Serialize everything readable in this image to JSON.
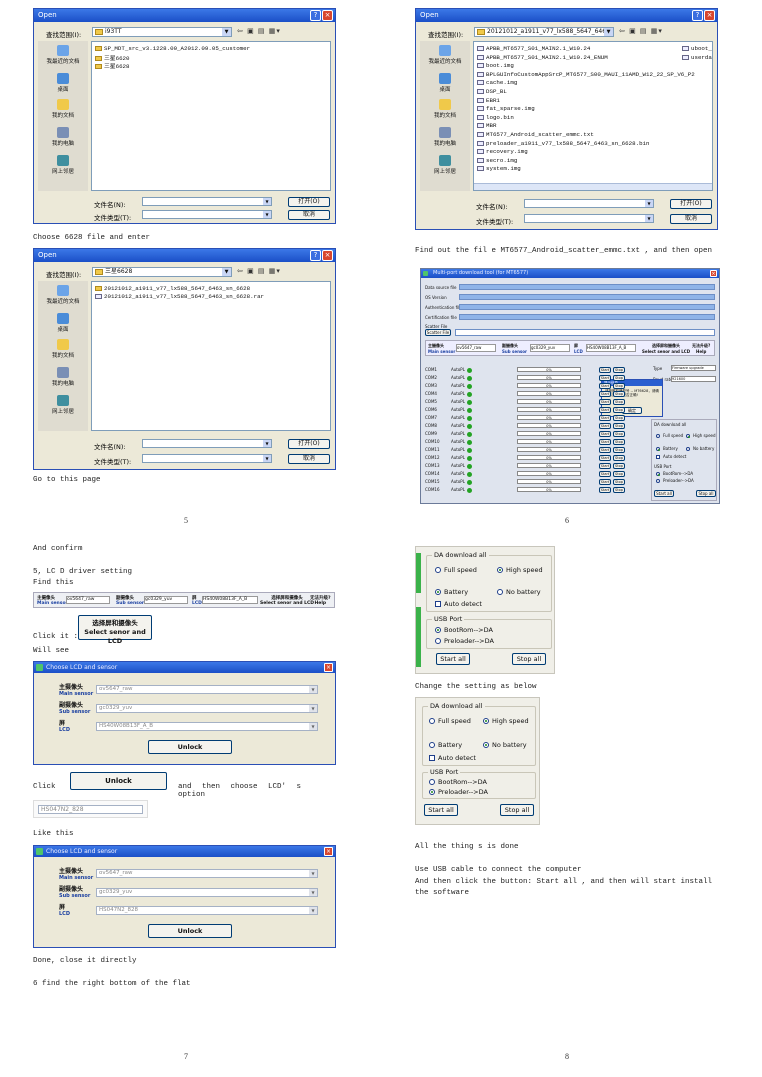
{
  "page_left_top": {
    "dialog1": {
      "title": "Open",
      "lookin_label": "查找范围(I):",
      "lookin_value": "i93TT",
      "toolbar_icons": "⇦ ▣ ▤ ▦▾",
      "places": [
        "我最近的文档",
        "桌面",
        "我的文档",
        "我的电脑",
        "网上邻居"
      ],
      "files": [
        "SP_MDT_src_v3.1228.00_A2012.09.05_customer",
        "三星6620",
        "三星6628"
      ],
      "filename_label": "文件名(N):",
      "filetype_label": "文件类型(T):",
      "open_button": "打开(O)",
      "cancel_button": "取消"
    },
    "caption1": "Choose 6628 file and enter",
    "dialog2": {
      "title": "Open",
      "lookin_label": "查找范围(I):",
      "lookin_value": "三星6628",
      "toolbar_icons": "⇦ ▣ ▤ ▦▾",
      "places": [
        "我最近的文档",
        "桌面",
        "我的文档",
        "我的电脑",
        "网上邻居"
      ],
      "files": [
        "20121012_a1911_v77_lx588_5647_6463_sn_6628",
        "20121012_a1911_v77_lx588_5647_6463_sn_6628.rar"
      ],
      "filename_label": "文件名(N):",
      "filetype_label": "文件类型(T):",
      "open_button": "打开(O)",
      "cancel_button": "取消"
    },
    "caption2": "Go to this page",
    "page_number": "5"
  },
  "page_right_top": {
    "dialog": {
      "title": "Open",
      "lookin_label": "查找范围(I):",
      "lookin_value": "20121012_a1911_v77_lx588_5647_6463_s",
      "toolbar_icons": "⇦ ▣ ▤ ▦▾",
      "places": [
        "我最近的文档",
        "桌面",
        "我的文档",
        "我的电脑",
        "网上邻居"
      ],
      "files": [
        "APBB_MT6577_S01_MAIN2.1_W10.24",
        "APBB_MT6577_S01_MAIN2.1_W10.24_ENUM",
        "boot.img",
        "BPLGUInfoCustomAppSrcP_MT6577_S00_MAUI_11AMD_W12_22_SP_V6_P2",
        "cache.img",
        "DSP_BL",
        "EBR1",
        "fat_sparse.img",
        "logo.bin",
        "MBR",
        "MT6577_Android_scatter_emmc.txt",
        "preloader_a1911_v77_lx588_5647_6463_sn_6628.bin",
        "recovery.img",
        "secro.img",
        "system.img"
      ],
      "files_col2": [
        "uboot_a",
        "userdat"
      ],
      "filename_label": "文件名(N):",
      "filetype_label": "文件类型(T):",
      "open_button": "打开(O)",
      "cancel_button": "取消"
    },
    "caption": "Find  out  the  fil e  MT6577_Android_scatter_emmc.txt  ,  and  then  open",
    "flash_tool": {
      "title": "Multi-port download tool (for MT6577)",
      "row_labels": [
        "Data source file",
        "OS Version",
        "Authentication file",
        "Certification file"
      ],
      "scatter_label": "Scatter File",
      "scatter_button": "Scatter File",
      "main_sensor_label": "主摄像头",
      "main_sensor_en": "Main sensor",
      "main_sensor_value": "ov5647_raw",
      "sub_sensor_label": "副摄像头",
      "sub_sensor_en": "Sub sensor",
      "sub_sensor_value": "gc0329_yuv",
      "lcd_label": "屏",
      "lcd_en": "LCD",
      "lcd_value": "HS40W08B13F_A_B",
      "select_button": "选择屏和摄像头",
      "select_button_en": "Select senor and LCD",
      "help_button": "无法升级?",
      "help_button_en": "Help",
      "com_ports": [
        "COM1",
        "COM2",
        "COM3",
        "COM4",
        "COM5",
        "COM6",
        "COM7",
        "COM8",
        "COM9",
        "COM10",
        "COM11",
        "COM12",
        "COM13",
        "COM14",
        "COM15",
        "COM16"
      ],
      "auto_label": "AutoPL",
      "progress_text": "0%",
      "start": "Start",
      "stop": "Stop",
      "type_label": "Type",
      "type_value": "Firmware upgrade",
      "baud_label": "Baud rate",
      "baud_value": "921600",
      "popup_title": "提示信息",
      "popup_text": "请按照机器型号 -- MT6628，请确认方案选择是否正确!",
      "popup_button": "确定",
      "da_title": "DA download all",
      "full_speed": "Full speed",
      "high_speed": "High speed",
      "battery": "Battery",
      "no_battery": "No battery",
      "auto_detect": "Auto detect",
      "usb_port": "USB Port",
      "bootrom": "BootRom-->DA",
      "preloader": "Preloader-->DA",
      "start_all": "Start all",
      "stop_all": "Stop all"
    },
    "page_number": "6"
  },
  "page_left_bottom": {
    "caption_confirm": "And confirm",
    "caption_lcd_setting": "5, LC D driver setting",
    "caption_find": "Find this",
    "sensor_strip": {
      "main_sensor_label": "主摄像头",
      "main_sensor_en": "Main sensor",
      "main_sensor_value": "ov5647_raw",
      "sub_sensor_label": "副摄像头",
      "sub_sensor_en": "Sub sensor",
      "sub_sensor_value": "gc0329_yuv",
      "lcd_label": "屏",
      "lcd_en": "LCD",
      "lcd_value": "HS40W08B13F_A_B",
      "select_label": "选择屏和摄像头",
      "select_en": "Select senor and LCD",
      "help_label": "无法升级?",
      "help_en": "Help"
    },
    "caption_click": "Click it :",
    "big_button": {
      "line1": "选择屏和摄像头",
      "line2": "Select senor and LCD"
    },
    "caption_will_see": "Will see",
    "dialog1": {
      "title": "Choose LCD and sensor",
      "main_label": "主摄像头",
      "main_en": "Main sensor",
      "main_value": "ov5647_raw",
      "sub_label": "副摄像头",
      "sub_en": "Sub sensor",
      "sub_value": "gc0329_yuv",
      "lcd_label": "屏",
      "lcd_en": "LCD",
      "lcd_value": "HS40W08B13F_A_B",
      "unlock": "Unlock"
    },
    "caption_click2": "Click",
    "unlock_button": "Unlock",
    "caption_then_choose": "and  then  choose  LCD' s  option",
    "lcd_option_value": "HS047N2_828",
    "caption_like_this": "Like this",
    "dialog2": {
      "title": "Choose LCD and sensor",
      "main_label": "主摄像头",
      "main_en": "Main sensor",
      "main_value": "ov5647_raw",
      "sub_label": "副摄像头",
      "sub_en": "Sub sensor",
      "sub_value": "gc0329_yuv",
      "lcd_label": "屏",
      "lcd_en": "LCD",
      "lcd_value": "HS047N2_828",
      "unlock": "Unlock"
    },
    "caption_done": "Done, close it directly",
    "caption_find_right": "6 find the right bottom of the flat",
    "page_number": "7"
  },
  "page_right_bottom": {
    "panel1": {
      "da_title": "DA download all",
      "full_speed": "Full speed",
      "high_speed": "High speed",
      "battery": "Battery",
      "no_battery": "No battery",
      "auto_detect": "Auto detect",
      "usb_port": "USB Port",
      "bootrom": "BootRom-->DA",
      "preloader": "Preloader-->DA",
      "start_all": "Start all",
      "stop_all": "Stop all"
    },
    "caption_change": "Change the setting as below",
    "panel2": {
      "da_title": "DA download all",
      "full_speed": "Full speed",
      "high_speed": "High speed",
      "battery": "Battery",
      "no_battery": "No battery",
      "auto_detect": "Auto detect",
      "usb_port": "USB Port",
      "bootrom": "BootRom-->DA",
      "preloader": "Preloader-->DA",
      "start_all": "Start all",
      "stop_all": "Stop all"
    },
    "caption_done": "All the thing s is done",
    "caption_usb": "Use USB cable to connect the computer",
    "caption_click_start": "And then click the button:  Start all , and then will start install the software",
    "page_number": "8"
  },
  "colors": {
    "xp_title": "#1b4fc7",
    "xp_face": "#ece9d8",
    "green_dot": "#24a324",
    "flash_bar": "#8fb4e8"
  }
}
